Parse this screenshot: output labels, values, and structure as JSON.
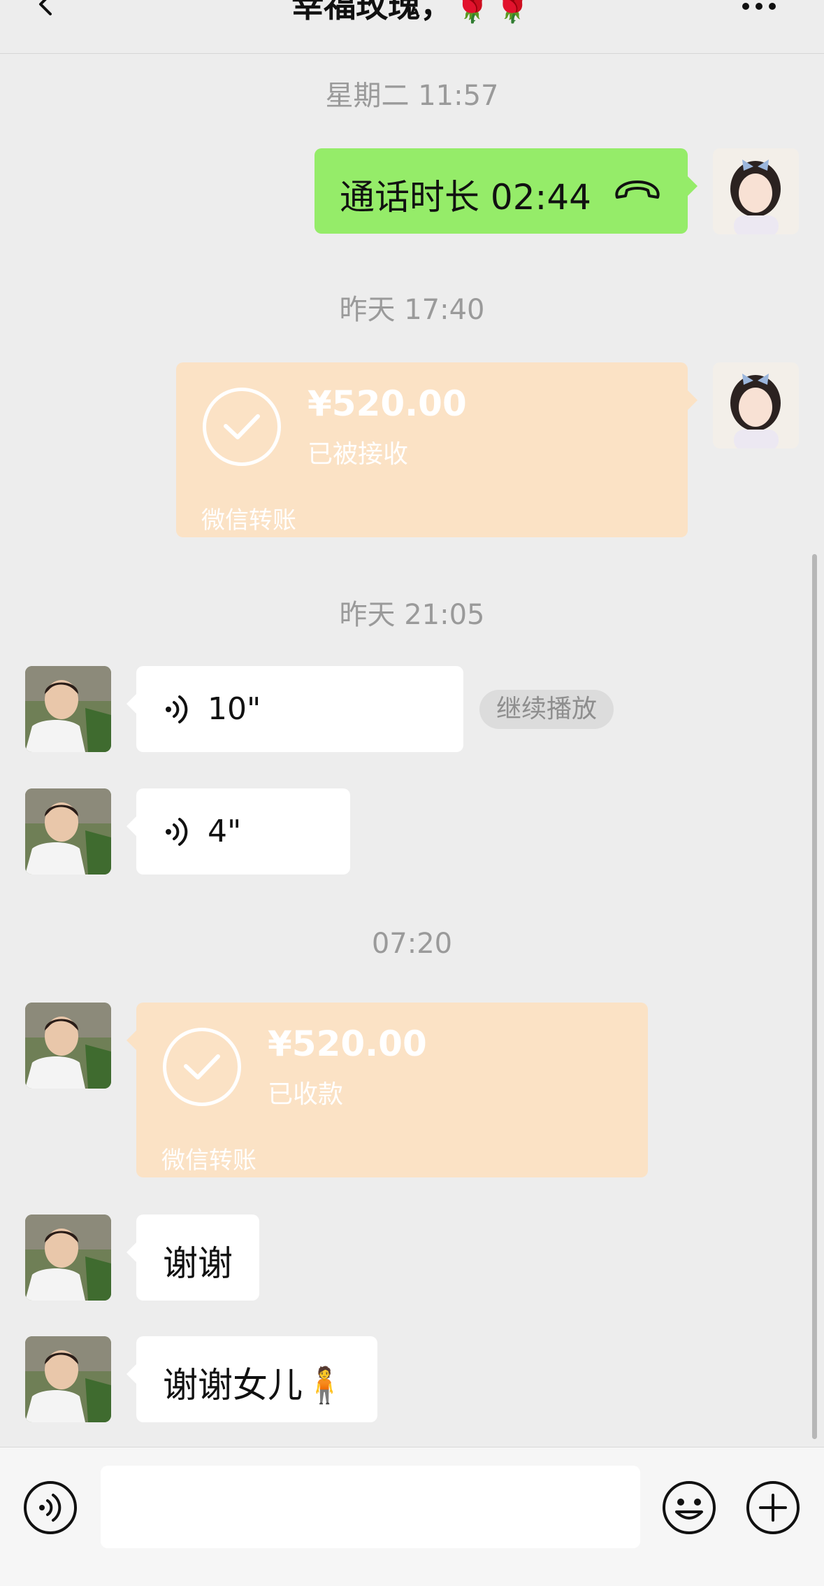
{
  "header": {
    "title": "幸福玫瑰，",
    "title_emoji": "🌹🌹"
  },
  "messages": {
    "ts1": "星期二 11:57",
    "call_label": "通话时长 02:44",
    "ts2": "昨天 17:40",
    "transfer1": {
      "amount": "¥520.00",
      "status": "已被接收",
      "brand": "微信转账"
    },
    "ts3": "昨天 21:05",
    "voice1": "10\"",
    "continue_play": "继续播放",
    "voice2": "4\"",
    "ts4": "07:20",
    "transfer2": {
      "amount": "¥520.00",
      "status": "已收款",
      "brand": "微信转账"
    },
    "text1": "谢谢",
    "text2": "谢谢女儿",
    "text2_emoji": "🧍"
  },
  "input": {
    "placeholder": ""
  },
  "colors": {
    "background": "#ededed",
    "self_bubble": "#95ec69",
    "transfer_card": "#fbe2c5",
    "other_bubble": "#ffffff"
  },
  "icons": [
    "back-icon",
    "more-icon",
    "phone-hangup-icon",
    "voice-wave-icon",
    "check-icon",
    "voice-input-icon",
    "emoji-icon",
    "plus-icon"
  ]
}
